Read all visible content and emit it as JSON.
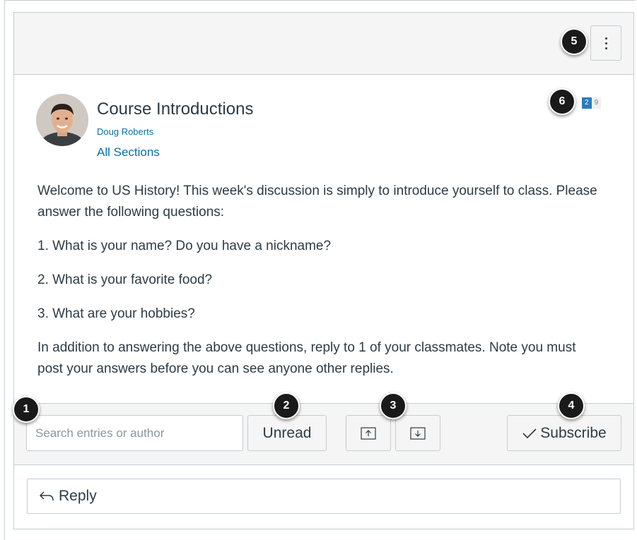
{
  "topic": {
    "title": "Course Introductions",
    "author": "Doug Roberts",
    "sections": "All Sections",
    "unread_count": "2",
    "total_count": "9",
    "body": [
      "Welcome to US History! This week's discussion is simply to introduce yourself to class. Please answer the following questions:",
      "1. What is your name? Do you have a nickname?",
      "2. What is your favorite food?",
      "3. What are your hobbies?",
      "In addition to answering the above questions, reply to 1 of your classmates. Note you must post your answers before you can see anyone other replies."
    ]
  },
  "toolbar": {
    "search_placeholder": "Search entries or author",
    "unread_label": "Unread",
    "subscribe_label": "Subscribe"
  },
  "reply": {
    "label": "Reply"
  },
  "callouts": [
    "1",
    "2",
    "3",
    "4",
    "5",
    "6"
  ],
  "colors": {
    "link": "#0770a3",
    "unread_badge": "#2b7abc",
    "callout": "#1a1a1a"
  }
}
